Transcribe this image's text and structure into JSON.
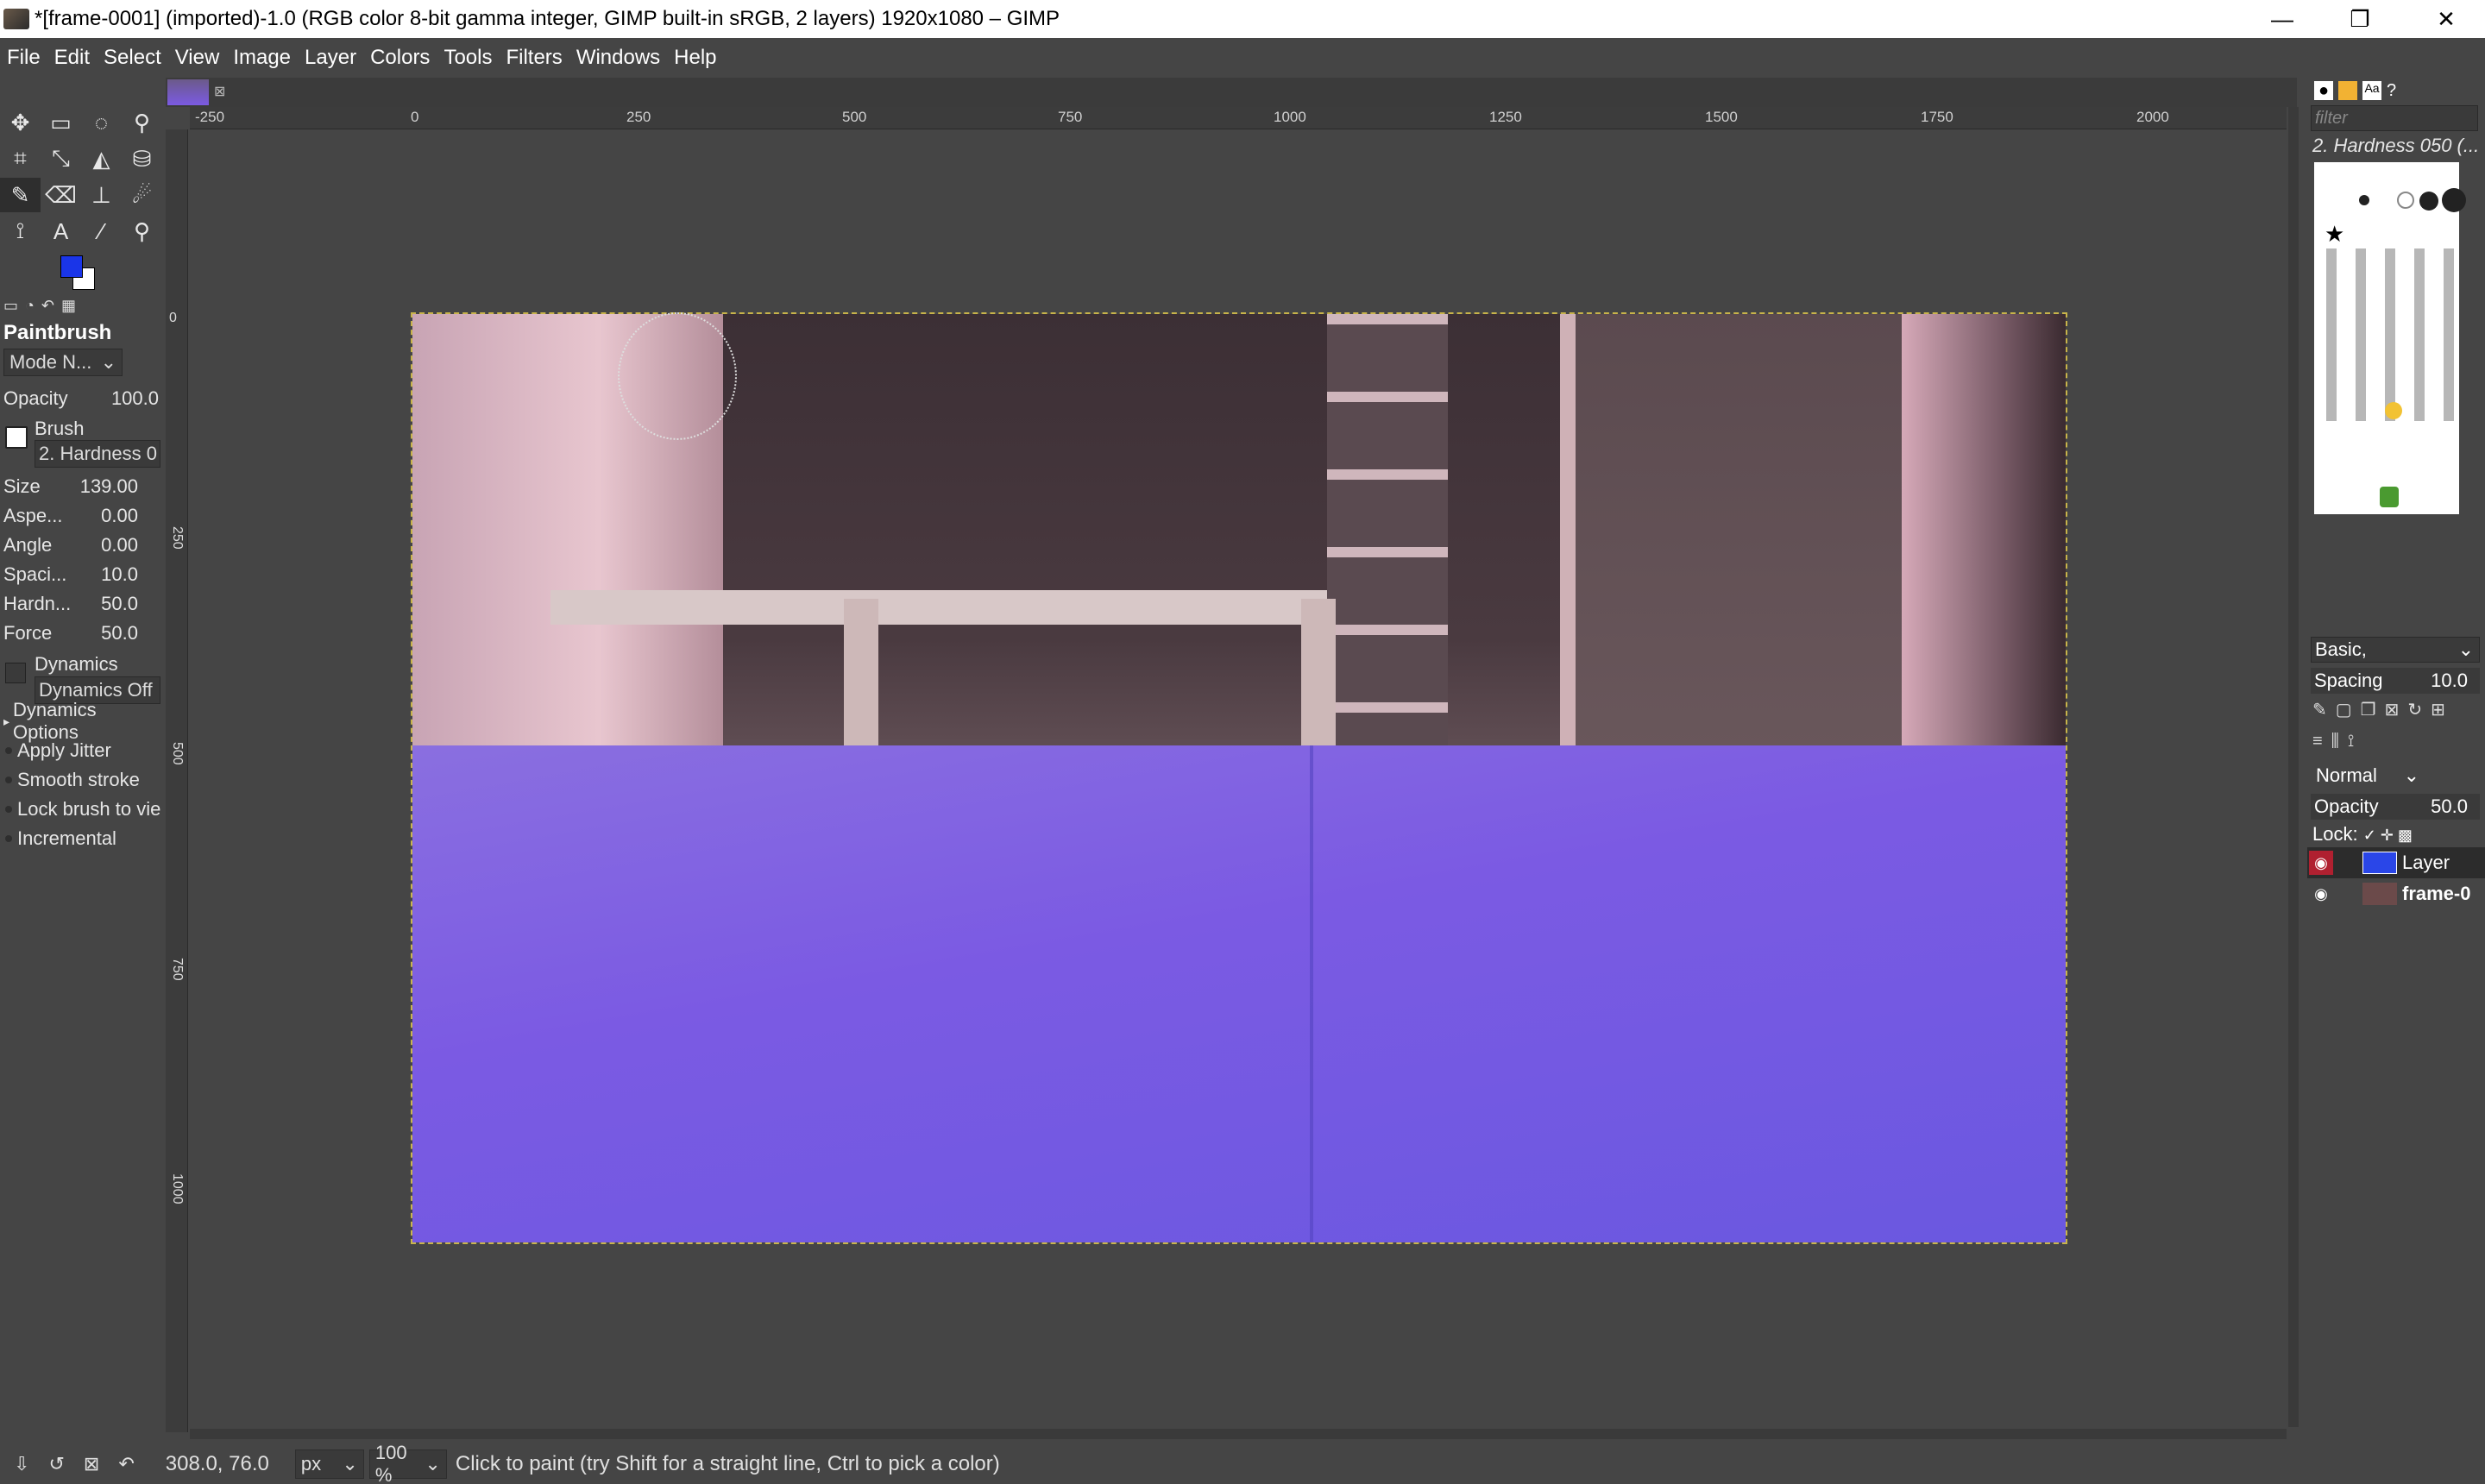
{
  "window": {
    "title": "*[frame-0001] (imported)-1.0 (RGB color 8-bit gamma integer, GIMP built-in sRGB, 2 layers) 1920x1080 – GIMP",
    "minimize": "—",
    "restore": "❐",
    "close": "✕"
  },
  "menu": [
    "File",
    "Edit",
    "Select",
    "View",
    "Image",
    "Layer",
    "Colors",
    "Tools",
    "Filters",
    "Windows",
    "Help"
  ],
  "ruler": {
    "h_ticks": [
      "-250",
      "0",
      "250",
      "500",
      "750",
      "1000",
      "1250",
      "1500",
      "1750",
      "2000"
    ],
    "v_ticks": [
      "0",
      "250",
      "500",
      "750",
      "1000"
    ]
  },
  "tool_options": {
    "title": "Paintbrush",
    "mode": "Mode N...",
    "opacity_label": "Opacity",
    "opacity_value": "100.0",
    "brush_label": "Brush",
    "brush_name": "2. Hardness 0",
    "size_label": "Size",
    "size_value": "139.00",
    "aspect_label": "Aspe...",
    "aspect_value": "0.00",
    "angle_label": "Angle",
    "angle_value": "0.00",
    "spacing_label": "Spaci...",
    "spacing_value": "10.0",
    "hardness_label": "Hardn...",
    "hardness_value": "50.0",
    "force_label": "Force",
    "force_value": "50.0",
    "dynamics_label": "Dynamics",
    "dynamics_value": "Dynamics Off",
    "dynamics_options": "Dynamics Options",
    "apply_jitter": "Apply Jitter",
    "smooth_stroke": "Smooth stroke",
    "lock_brush": "Lock brush to vie",
    "incremental": "Incremental"
  },
  "brushes_panel": {
    "filter_placeholder": "filter",
    "selected_brush": "2. Hardness 050 (...",
    "preset": "Basic,",
    "spacing_label": "Spacing",
    "spacing_value": "10.0"
  },
  "layers_panel": {
    "mode": "Normal",
    "opacity_label": "Opacity",
    "opacity_value": "50.0",
    "lock_label": "Lock:",
    "layers": [
      {
        "name": "Layer"
      },
      {
        "name": "frame-0"
      }
    ]
  },
  "status": {
    "coords": "308.0, 76.0",
    "unit": "px",
    "zoom": "100 %",
    "message": "Click to paint (try Shift for a straight line, Ctrl to pick a color)"
  },
  "colors": {
    "fg": "#1a35e8",
    "bg": "#ffffff"
  }
}
